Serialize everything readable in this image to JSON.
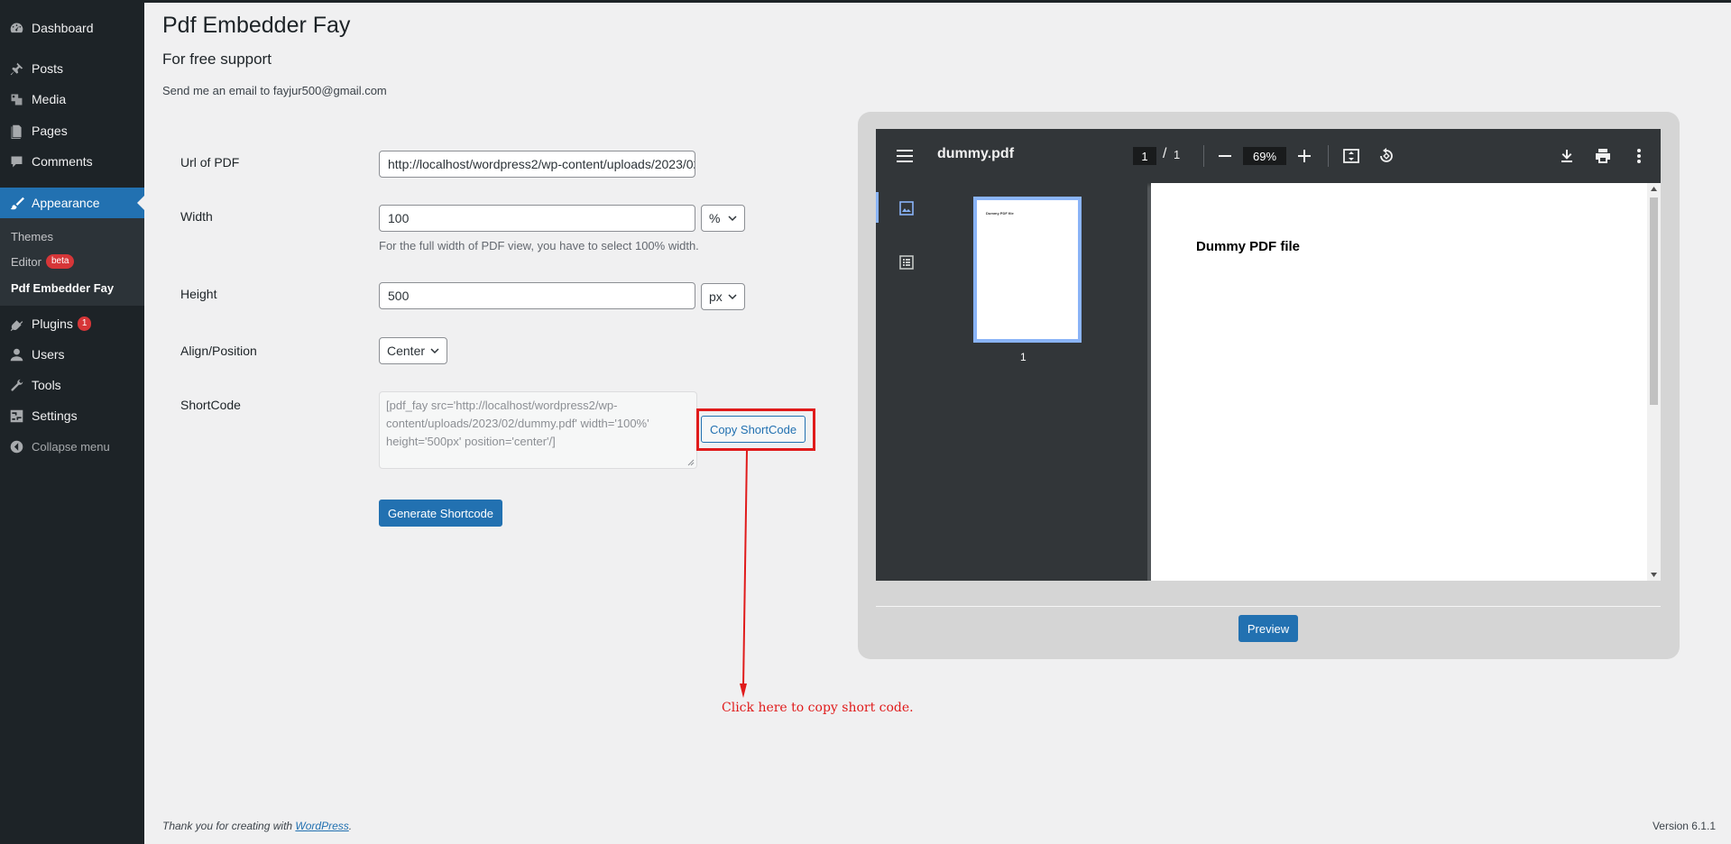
{
  "sidebar": {
    "items": [
      {
        "label": "Dashboard",
        "icon": "dashboard-icon"
      },
      {
        "label": "Posts",
        "icon": "pin-icon"
      },
      {
        "label": "Media",
        "icon": "media-icon"
      },
      {
        "label": "Pages",
        "icon": "pages-icon"
      },
      {
        "label": "Comments",
        "icon": "comment-icon"
      },
      {
        "label": "Appearance",
        "icon": "brush-icon"
      },
      {
        "label": "Plugins",
        "icon": "plugin-icon",
        "badge": "1"
      },
      {
        "label": "Users",
        "icon": "user-icon"
      },
      {
        "label": "Tools",
        "icon": "wrench-icon"
      },
      {
        "label": "Settings",
        "icon": "settings-icon"
      }
    ],
    "submenu": [
      {
        "label": "Themes"
      },
      {
        "label": "Editor",
        "badge": "beta"
      },
      {
        "label": "Pdf Embedder Fay"
      }
    ],
    "collapse_label": "Collapse menu"
  },
  "page": {
    "title": "Pdf Embedder Fay",
    "support_heading": "For free support",
    "support_text": "Send me an email to fayjur500@gmail.com"
  },
  "form": {
    "url_label": "Url of PDF",
    "url_value": "http://localhost/wordpress2/wp-content/uploads/2023/02/dummy.pdf",
    "width_label": "Width",
    "width_value": "100",
    "width_unit": "%",
    "width_help": "For the full width of PDF view, you have to select 100% width.",
    "height_label": "Height",
    "height_value": "500",
    "height_unit": "px",
    "align_label": "Align/Position",
    "align_value": "Center",
    "shortcode_label": "ShortCode",
    "shortcode_value": "[pdf_fay src='http://localhost/wordpress2/wp-content/uploads/2023/02/dummy.pdf' width='100%' height='500px' position='center'/]",
    "copy_button": "Copy ShortCode",
    "generate_button": "Generate Shortcode"
  },
  "annotation": {
    "text": "Click here to copy short code.",
    "color": "#e01b1b"
  },
  "viewer": {
    "file_name": "dummy.pdf",
    "current_page": "1",
    "page_separator": "/",
    "total_pages": "1",
    "zoom": "69%",
    "thumbnail_label": "1",
    "thumbnail_text": "Dummy PDF file",
    "document_heading": "Dummy PDF file",
    "preview_button": "Preview"
  },
  "footer": {
    "thanks_prefix": "Thank you for creating with ",
    "thanks_link": "WordPress",
    "thanks_suffix": ".",
    "version": "Version 6.1.1"
  },
  "colors": {
    "sidebar_bg": "#1d2327",
    "accent": "#2271b1",
    "badge": "#d63638",
    "highlight": "#e01b1b"
  }
}
